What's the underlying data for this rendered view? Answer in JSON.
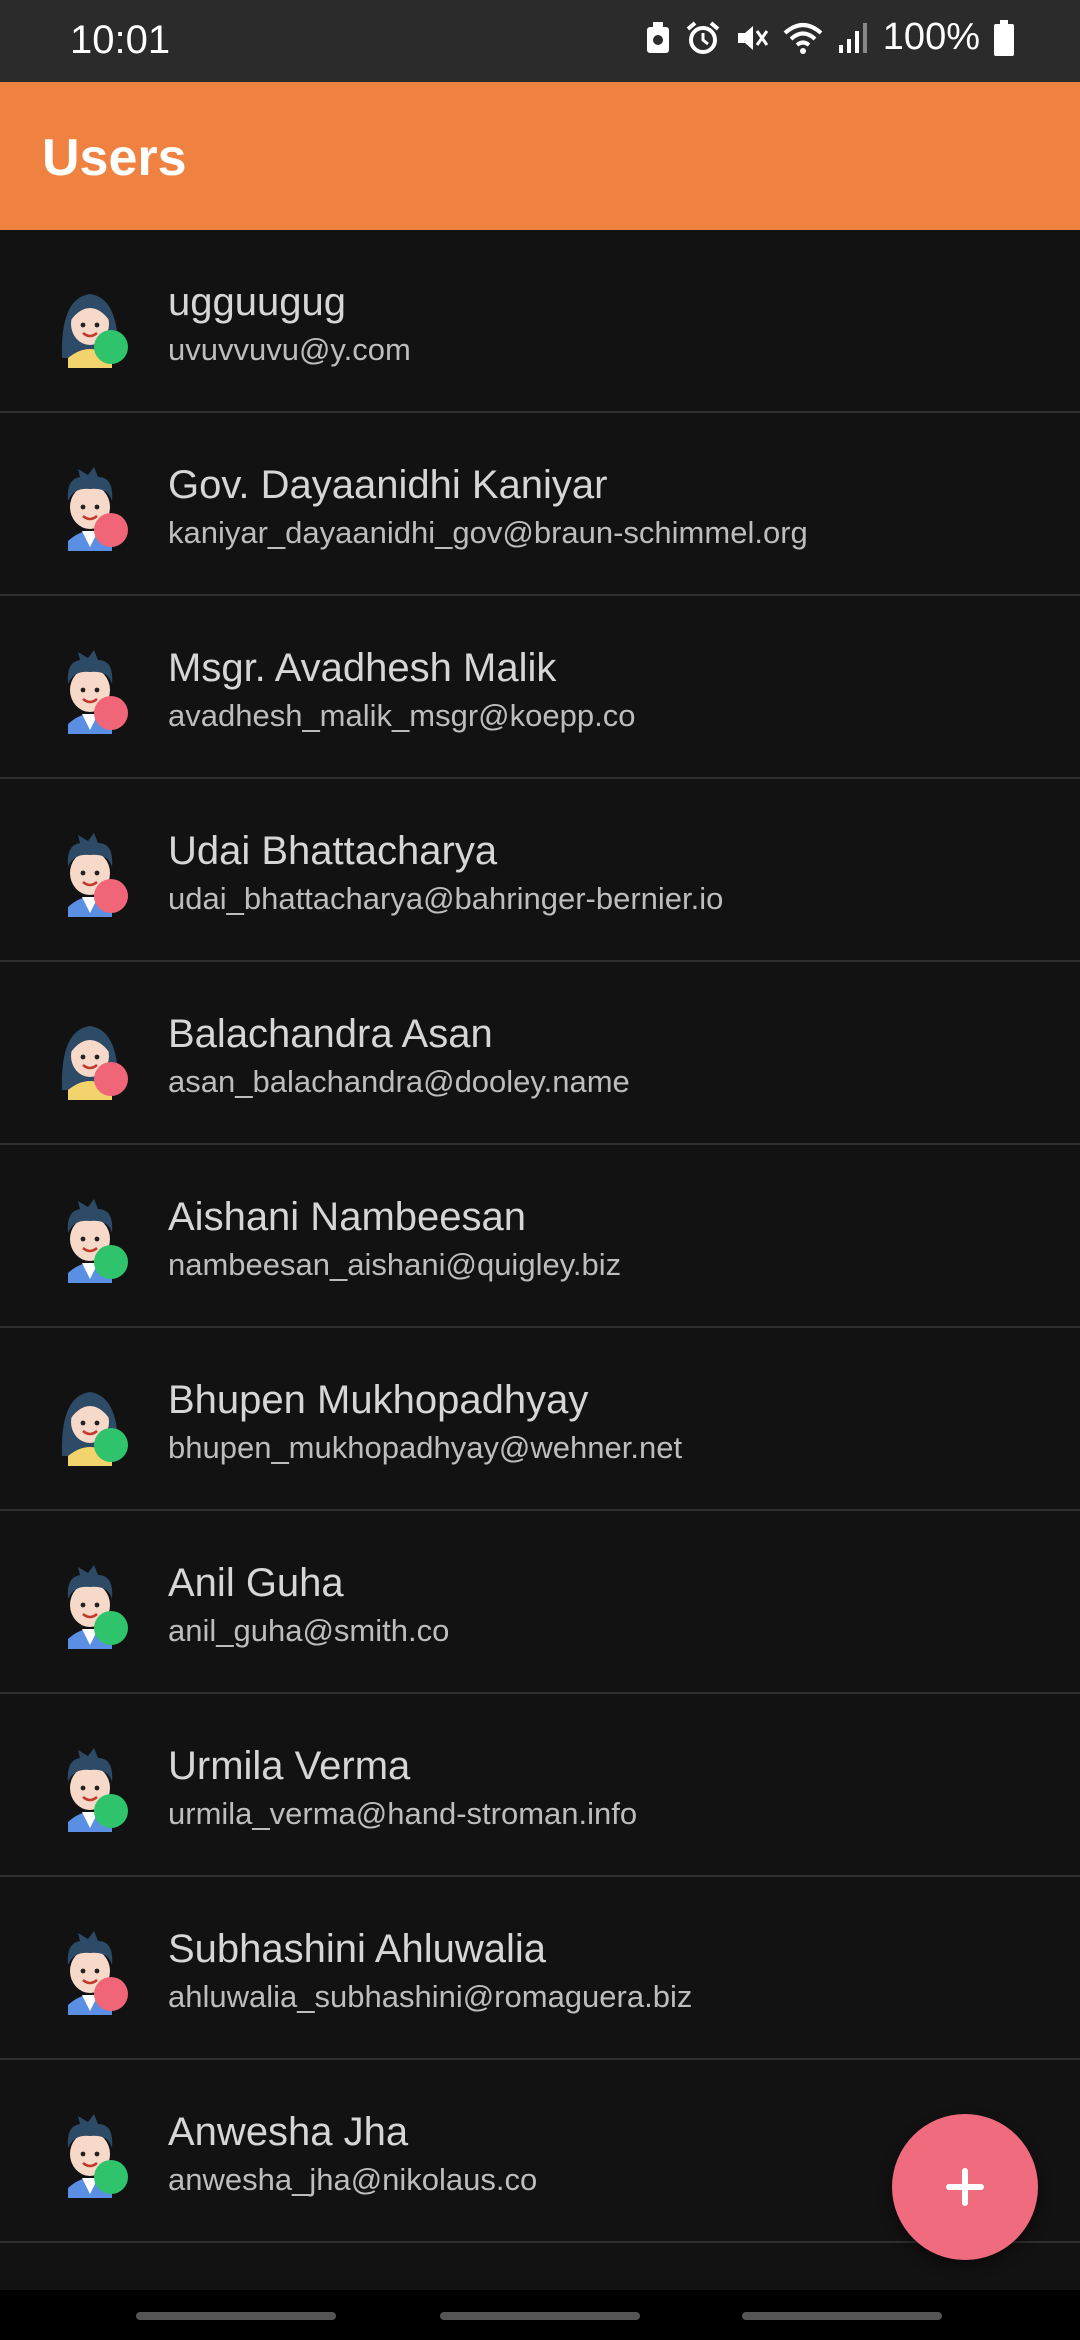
{
  "status_bar": {
    "time": "10:01",
    "battery": "100%",
    "icons": [
      "cleaner-icon",
      "alarm-icon",
      "mute-icon",
      "wifi-icon",
      "signal-icon",
      "battery-icon"
    ]
  },
  "app_bar": {
    "title": "Users"
  },
  "colors": {
    "online": "#2fc36b",
    "offline": "#f06577",
    "accent": "#ef8241",
    "fab": "#f06b7e"
  },
  "users": [
    {
      "name": "ugguugug",
      "email": "uvuvvuvu@y.com",
      "avatar": "female",
      "status": "online"
    },
    {
      "name": "Gov. Dayaanidhi Kaniyar",
      "email": "kaniyar_dayaanidhi_gov@braun-schimmel.org",
      "avatar": "male",
      "status": "offline"
    },
    {
      "name": "Msgr. Avadhesh Malik",
      "email": "avadhesh_malik_msgr@koepp.co",
      "avatar": "male",
      "status": "offline"
    },
    {
      "name": "Udai Bhattacharya",
      "email": "udai_bhattacharya@bahringer-bernier.io",
      "avatar": "male",
      "status": "offline"
    },
    {
      "name": "Balachandra Asan",
      "email": "asan_balachandra@dooley.name",
      "avatar": "female",
      "status": "offline"
    },
    {
      "name": "Aishani Nambeesan",
      "email": "nambeesan_aishani@quigley.biz",
      "avatar": "male",
      "status": "online"
    },
    {
      "name": "Bhupen Mukhopadhyay",
      "email": "bhupen_mukhopadhyay@wehner.net",
      "avatar": "female",
      "status": "online"
    },
    {
      "name": "Anil Guha",
      "email": "anil_guha@smith.co",
      "avatar": "male",
      "status": "online"
    },
    {
      "name": "Urmila Verma",
      "email": "urmila_verma@hand-stroman.info",
      "avatar": "male",
      "status": "online"
    },
    {
      "name": "Subhashini Ahluwalia",
      "email": "ahluwalia_subhashini@romaguera.biz",
      "avatar": "male",
      "status": "offline"
    },
    {
      "name": "Anwesha Jha",
      "email": "anwesha_jha@nikolaus.co",
      "avatar": "male",
      "status": "online"
    },
    {
      "name": "",
      "email": "",
      "avatar": "male",
      "status": "online"
    }
  ],
  "fab": {
    "icon": "plus-icon"
  }
}
